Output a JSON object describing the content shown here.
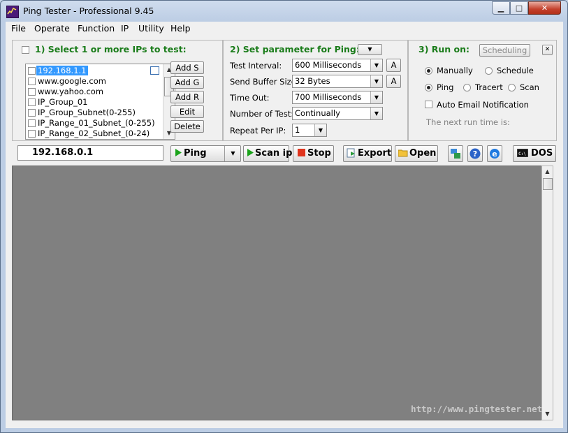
{
  "window": {
    "title": "Ping Tester - Professional  9.45",
    "controls": {
      "minimize": "▁",
      "maximize": "□",
      "close": "✕"
    }
  },
  "menu": [
    "File",
    "Operate",
    "Function",
    "IP",
    "Utility",
    "Help"
  ],
  "section1": {
    "title": "1) Select 1 or more IPs to test:",
    "ips": [
      {
        "label": "192.168.1.1",
        "selected": true
      },
      {
        "label": "www.google.com"
      },
      {
        "label": "www.yahoo.com"
      },
      {
        "label": "IP_Group_01"
      },
      {
        "label": "IP_Group_Subnet(0-255)"
      },
      {
        "label": "IP_Range_01_Subnet_(0-255)"
      },
      {
        "label": "IP_Range_02_Subnet_(0-24)"
      }
    ],
    "buttons": {
      "add_s": "Add S",
      "add_g": "Add G",
      "add_r": "Add R",
      "edit": "Edit",
      "delete": "Delete"
    }
  },
  "section2": {
    "title": "2) Set parameter for Ping:",
    "fields": {
      "test_interval": {
        "label": "Test Interval:",
        "value": "600  Milliseconds"
      },
      "send_buffer": {
        "label": "Send Buffer Size:",
        "value": "32  Bytes"
      },
      "time_out": {
        "label": "Time Out:",
        "value": "700  Milliseconds"
      },
      "number_of_test": {
        "label": "Number of Test:",
        "value": "Continually"
      },
      "repeat_per_ip": {
        "label": "Repeat Per IP:",
        "value": "1"
      }
    },
    "a_button": "A"
  },
  "section3": {
    "title": "3) Run on:",
    "scheduling_button": "Scheduling",
    "manually": "Manually",
    "schedule": "Schedule",
    "ping": "Ping",
    "tracert": "Tracert",
    "scan": "Scan",
    "auto_email": "Auto Email Notification",
    "next_run": "The next run time is:"
  },
  "toolbar": {
    "ip_value": "192.168.0.1",
    "ping": "Ping",
    "scan_ip": "Scan ip",
    "stop": "Stop",
    "export": "Export",
    "open": "Open",
    "dos": "DOS"
  },
  "watermark": "http://www.pingtester.net",
  "colors": {
    "section_title": "#1a7c1a",
    "output_bg": "#808080",
    "selection": "#3399ff"
  }
}
